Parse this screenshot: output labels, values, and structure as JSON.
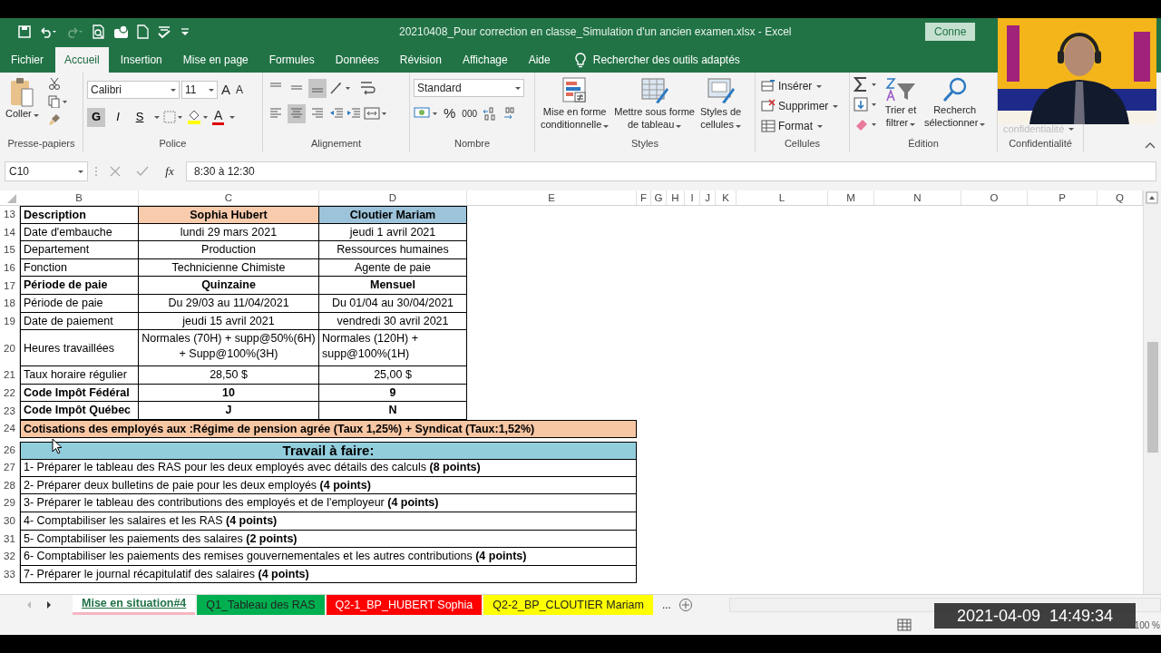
{
  "window": {
    "title": "20210408_Pour correction en classe_Simulation d'un ancien examen.xlsx  -  Excel",
    "account_button": "Conne"
  },
  "ribbon_tabs": [
    {
      "label": "Fichier",
      "selected": false
    },
    {
      "label": "Accueil",
      "selected": true
    },
    {
      "label": "Insertion",
      "selected": false
    },
    {
      "label": "Mise en page",
      "selected": false
    },
    {
      "label": "Formules",
      "selected": false
    },
    {
      "label": "Données",
      "selected": false
    },
    {
      "label": "Révision",
      "selected": false
    },
    {
      "label": "Affichage",
      "selected": false
    },
    {
      "label": "Aide",
      "selected": false
    }
  ],
  "search": {
    "label": "Rechercher des outils adaptés"
  },
  "ribbon": {
    "groups": [
      {
        "label": "Presse-papiers",
        "items": [
          {
            "kind": "big",
            "label": "Coller"
          }
        ]
      },
      {
        "label": "Police",
        "items": [
          {
            "kind": "combo",
            "value": "Calibri"
          },
          {
            "kind": "combo",
            "value": "11"
          },
          {
            "kind": "glyph",
            "label": "A"
          },
          {
            "kind": "glyph",
            "label": "A"
          },
          {
            "kind": "toggle",
            "label": "G",
            "on": true
          },
          {
            "kind": "toggle",
            "label": "I",
            "on": false
          },
          {
            "kind": "toggle",
            "label": "S",
            "on": false
          },
          {
            "kind": "glyph",
            "label": "A"
          }
        ]
      },
      {
        "label": "Alignement",
        "items": [
          {
            "kind": "align",
            "on": false
          },
          {
            "kind": "align",
            "on": false
          },
          {
            "kind": "align",
            "on": true
          },
          {
            "kind": "align",
            "on": false
          },
          {
            "kind": "align",
            "on": true
          },
          {
            "kind": "align",
            "on": false
          }
        ]
      },
      {
        "label": "Nombre",
        "items": [
          {
            "kind": "combo",
            "value": "Standard"
          },
          {
            "kind": "glyph",
            "label": "%"
          },
          {
            "kind": "glyph",
            "label": "000"
          }
        ]
      },
      {
        "label": "Styles",
        "items": [
          {
            "kind": "big",
            "label": "Mise en forme\nconditionnelle"
          },
          {
            "kind": "big",
            "label": "Mettre sous forme\nde tableau"
          },
          {
            "kind": "big",
            "label": "Styles de\ncellules"
          }
        ]
      },
      {
        "label": "Cellules",
        "items": [
          {
            "kind": "small",
            "label": "Insérer"
          },
          {
            "kind": "small",
            "label": "Supprimer"
          },
          {
            "kind": "small",
            "label": "Format"
          }
        ]
      },
      {
        "label": "Édition",
        "items": [
          {
            "kind": "big",
            "label": "Trier et\nfiltrer"
          },
          {
            "kind": "big",
            "label": "Recherch\nsélectionner"
          }
        ]
      },
      {
        "label": "Confidentialité",
        "items": [
          {
            "kind": "faded",
            "label": "confidentialité"
          }
        ]
      }
    ]
  },
  "formula_bar": {
    "name_box": "C10",
    "function_label": "fx",
    "formula": "8:30 à 12:30"
  },
  "columns": [
    "B",
    "C",
    "D",
    "E",
    "F",
    "G",
    "H",
    "I",
    "J",
    "K",
    "L",
    "M",
    "N",
    "O",
    "P",
    "Q"
  ],
  "rows": [
    {
      "number": "13",
      "kind": "pair",
      "bold": true,
      "cells": [
        {
          "text": "Description"
        },
        {
          "text": "Sophia Hubert",
          "color": "#f8cbad"
        },
        {
          "text": "Cloutier Mariam",
          "color": "#9cc3da"
        }
      ]
    },
    {
      "number": "14",
      "kind": "pair",
      "bold": false,
      "cells": [
        {
          "text": "Date d'embauche"
        },
        {
          "text": "lundi 29 mars 2021"
        },
        {
          "text": "jeudi 1 avril 2021"
        }
      ]
    },
    {
      "number": "15",
      "kind": "pair",
      "bold": false,
      "cells": [
        {
          "text": "Departement"
        },
        {
          "text": "Production"
        },
        {
          "text": "Ressources humaines"
        }
      ]
    },
    {
      "number": "16",
      "kind": "pair",
      "bold": false,
      "cells": [
        {
          "text": "Fonction"
        },
        {
          "text": "Technicienne Chimiste"
        },
        {
          "text": "Agente de paie"
        }
      ]
    },
    {
      "number": "17",
      "kind": "pair",
      "bold": true,
      "cells": [
        {
          "text": "Période de paie"
        },
        {
          "text": "Quinzaine"
        },
        {
          "text": "Mensuel"
        }
      ]
    },
    {
      "number": "18",
      "kind": "pair",
      "bold": false,
      "cells": [
        {
          "text": "Période de paie"
        },
        {
          "text": "Du 29/03 au 11/04/2021"
        },
        {
          "text": "Du 01/04 au 30/04/2021"
        }
      ]
    },
    {
      "number": "19",
      "kind": "pair",
      "bold": false,
      "cells": [
        {
          "text": "Date de paiement"
        },
        {
          "text": "jeudi 15 avril 2021"
        },
        {
          "text": "vendredi 30 avril 2021"
        }
      ]
    },
    {
      "number": "20",
      "kind": "pair-wrap",
      "bold": false,
      "cells": [
        {
          "text": "Heures travaillées"
        },
        {
          "text": "Normales (70H) + supp@50%(6H) + Supp@100%(3H)"
        },
        {
          "text": "Normales (120H) + supp@100%(1H)"
        }
      ]
    },
    {
      "number": "21",
      "kind": "pair",
      "bold": false,
      "cells": [
        {
          "text": "Taux horaire régulier"
        },
        {
          "text": "28,50 $"
        },
        {
          "text": "25,00 $"
        }
      ]
    },
    {
      "number": "22",
      "kind": "pair",
      "bold": true,
      "cells": [
        {
          "text": "Code Impôt Fédéral"
        },
        {
          "text": "10"
        },
        {
          "text": "9"
        }
      ]
    },
    {
      "number": "23",
      "kind": "pair",
      "bold": true,
      "cells": [
        {
          "text": "Code Impôt Québec"
        },
        {
          "text": "J"
        },
        {
          "text": "N"
        }
      ]
    },
    {
      "number": "24",
      "kind": "banner",
      "color": "#f7c6a3",
      "text": "Cotisations des employés aux :Régime de pension agrée (Taux 1,25%) + Syndicat (Taux:1,52%)"
    },
    {
      "number": "26",
      "kind": "heading",
      "color": "#92cddc",
      "text": "Travail à faire:"
    },
    {
      "number": "27",
      "kind": "task",
      "text": "1- Préparer le tableau des RAS pour les deux employés avec détails des calculs **(8 points)**"
    },
    {
      "number": "28",
      "kind": "task",
      "text": "2- Préparer deux bulletins de paie pour les deux employés **(4 points)**"
    },
    {
      "number": "29",
      "kind": "task",
      "text": "3- Préparer  le tableau des contributions des employés et de l'employeur **(4 points)**"
    },
    {
      "number": "30",
      "kind": "task",
      "text": "4- Comptabiliser les salaires et les RAS  **(4 points)**"
    },
    {
      "number": "31",
      "kind": "task",
      "text": "5- Comptabiliser les paiements des salaires  **(2 points)**"
    },
    {
      "number": "32",
      "kind": "task",
      "text": "6- Comptabiliser les paiements des remises gouvernementales et les autres contributions  **(4 points)**"
    },
    {
      "number": "33",
      "kind": "task",
      "text": "7- Préparer le journal récapitulatif des salaires  **(4 points)**"
    }
  ],
  "sheet_tabs": [
    {
      "label": "Mise en situation#4",
      "selected": true,
      "color": "#f4b6c2"
    },
    {
      "label": "Q1_Tableau des RAS",
      "selected": false,
      "color": "#00b050"
    },
    {
      "label": "Q2-1_BP_HUBERT Sophia",
      "selected": false,
      "color": "#ff0000"
    },
    {
      "label": "Q2-2_BP_CLOUTIER Mariam",
      "selected": false,
      "color": "#ffff00"
    }
  ],
  "sheet_tabs_more": "...",
  "status_bar": {
    "zoom": "100 %"
  },
  "overlay_timestamp": "2021-04-09  14:49:34"
}
